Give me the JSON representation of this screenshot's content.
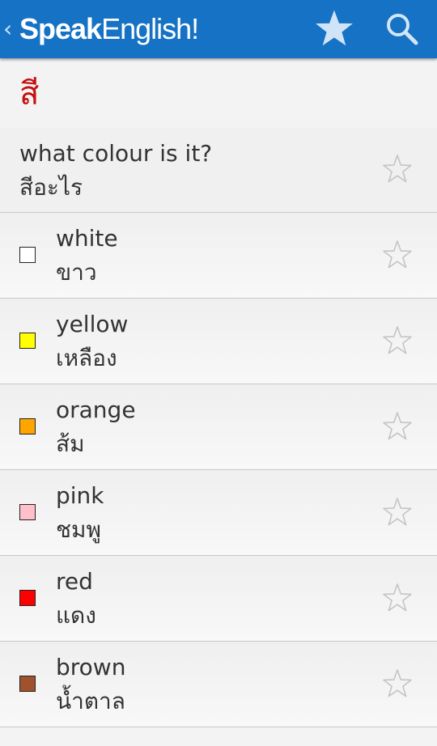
{
  "app": {
    "title_part1": "Speak",
    "title_part2": "English!",
    "back_icon": "chevron-left-icon",
    "favorites_icon": "star-filled-icon",
    "search_icon": "search-icon"
  },
  "category": {
    "heading": "สี"
  },
  "phrases": [
    {
      "english": "what colour is it?",
      "thai": "สีอะไร"
    }
  ],
  "colors": [
    {
      "english": "white",
      "thai": "ขาว",
      "swatch": "#ffffff"
    },
    {
      "english": "yellow",
      "thai": "เหลือง",
      "swatch": "#ffff00"
    },
    {
      "english": "orange",
      "thai": "ส้ม",
      "swatch": "#ffa500"
    },
    {
      "english": "pink",
      "thai": "ชมพู",
      "swatch": "#ffc0cb"
    },
    {
      "english": "red",
      "thai": "แดง",
      "swatch": "#ff0000"
    },
    {
      "english": "brown",
      "thai": "น้ำตาล",
      "swatch": "#a0522d"
    }
  ],
  "theme": {
    "appbar_color": "#1572c4",
    "heading_color": "#c50f0f"
  }
}
